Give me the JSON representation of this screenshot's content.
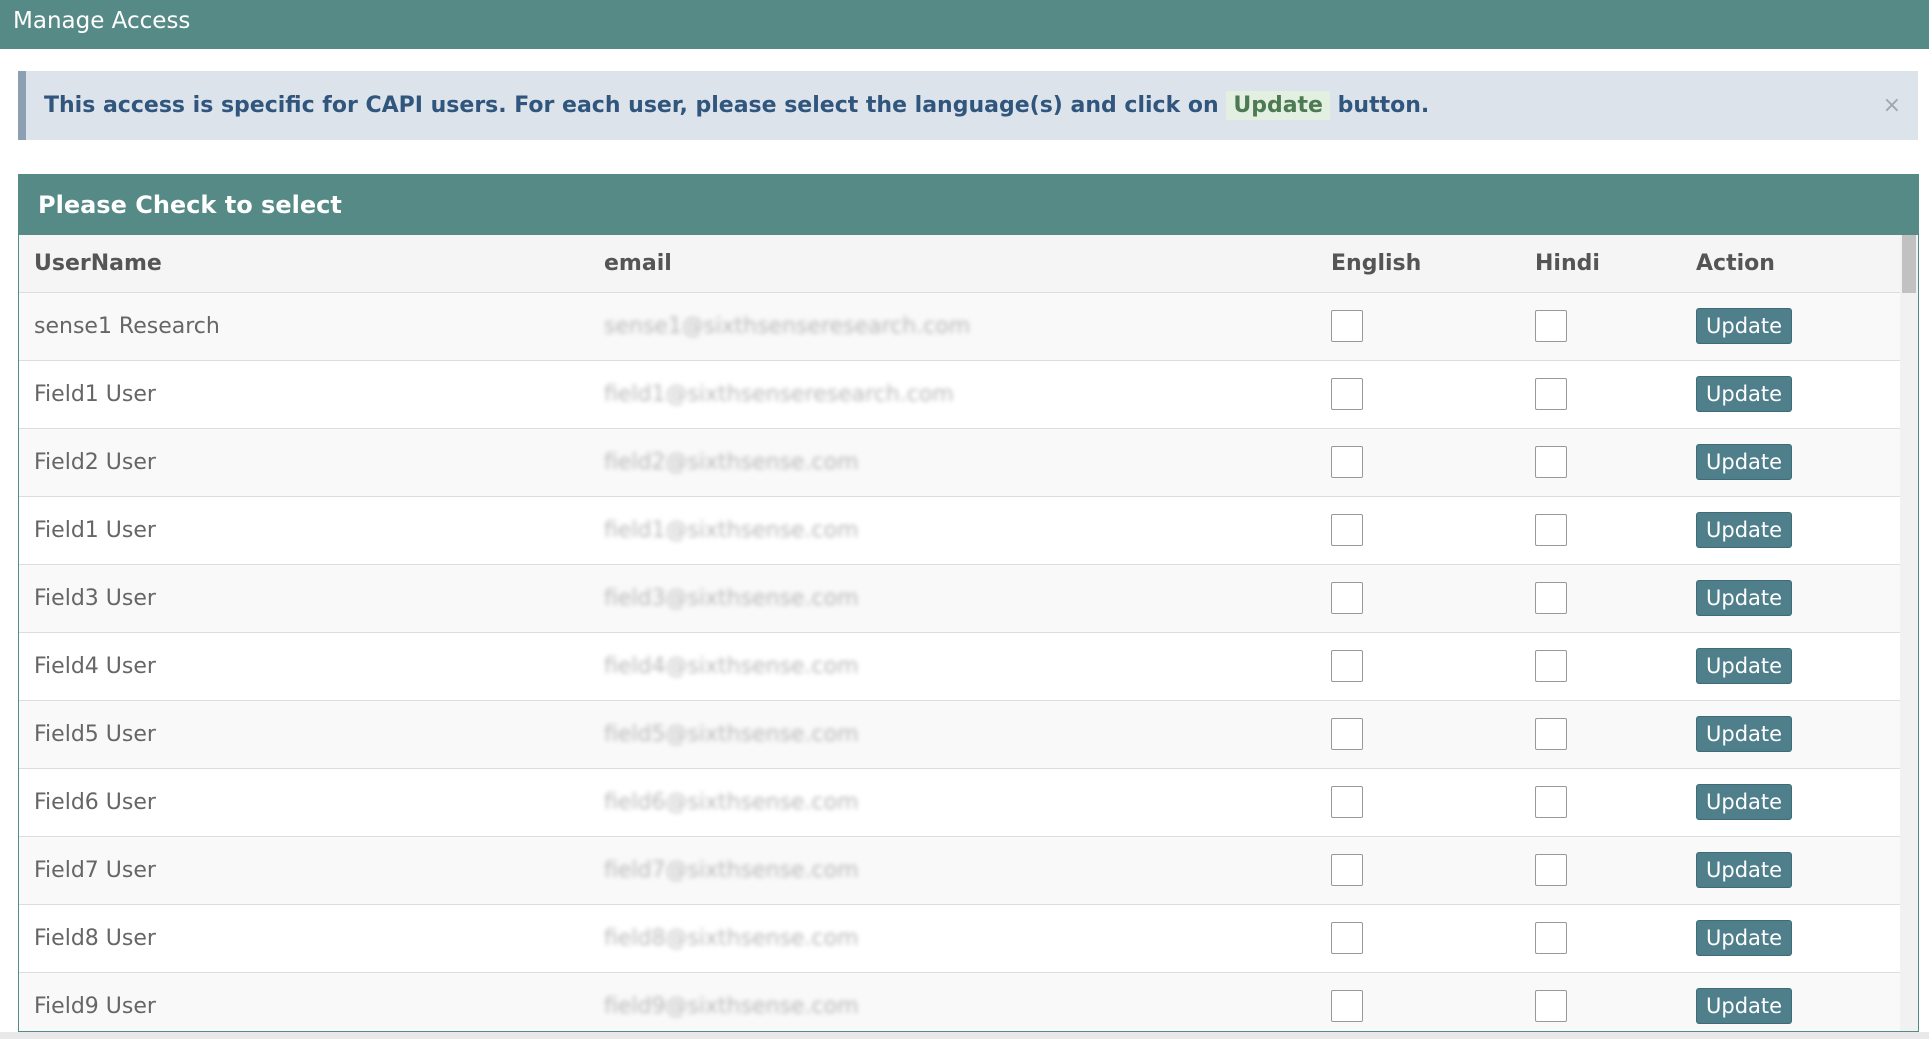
{
  "window": {
    "title": "Manage Access"
  },
  "alert": {
    "text_before": "This access is specific for CAPI users. For each user, please select the language(s) and click on",
    "keyword": "Update",
    "text_after": "button.",
    "close_glyph": "×"
  },
  "panel": {
    "title": "Please Check to select"
  },
  "table": {
    "columns": [
      "UserName",
      "email",
      "English",
      "Hindi",
      "Action"
    ],
    "rows": [
      {
        "username": "sense1 Research",
        "email": "sense1@sixthsenseresearch.com",
        "english": false,
        "hindi": false,
        "action": "Update"
      },
      {
        "username": "Field1 User",
        "email": "field1@sixthsenseresearch.com",
        "english": false,
        "hindi": false,
        "action": "Update"
      },
      {
        "username": "Field2 User",
        "email": "field2@sixthsense.com",
        "english": false,
        "hindi": false,
        "action": "Update"
      },
      {
        "username": "Field1 User",
        "email": "field1@sixthsense.com",
        "english": false,
        "hindi": false,
        "action": "Update"
      },
      {
        "username": "Field3 User",
        "email": "field3@sixthsense.com",
        "english": false,
        "hindi": false,
        "action": "Update"
      },
      {
        "username": "Field4 User",
        "email": "field4@sixthsense.com",
        "english": false,
        "hindi": false,
        "action": "Update"
      },
      {
        "username": "Field5 User",
        "email": "field5@sixthsense.com",
        "english": false,
        "hindi": false,
        "action": "Update"
      },
      {
        "username": "Field6 User",
        "email": "field6@sixthsense.com",
        "english": false,
        "hindi": false,
        "action": "Update"
      },
      {
        "username": "Field7 User",
        "email": "field7@sixthsense.com",
        "english": false,
        "hindi": false,
        "action": "Update"
      },
      {
        "username": "Field8 User",
        "email": "field8@sixthsense.com",
        "english": false,
        "hindi": false,
        "action": "Update"
      },
      {
        "username": "Field9 User",
        "email": "field9@sixthsense.com",
        "english": false,
        "hindi": false,
        "action": "Update"
      }
    ]
  },
  "colors": {
    "header_bar": "#568a86",
    "alert_bg": "#dce3eb",
    "alert_text": "#31567d",
    "update_button": "#4f7f8b"
  }
}
